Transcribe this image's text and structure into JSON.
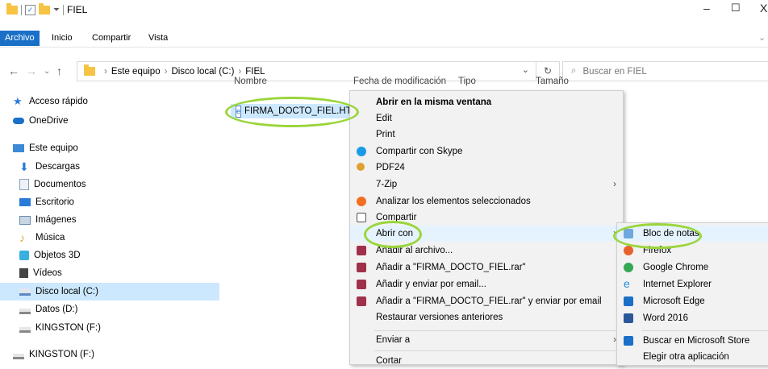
{
  "window": {
    "title": "FIEL",
    "controls": {
      "minimize": "–",
      "maximize": "☐",
      "close": "X"
    }
  },
  "ribbon": {
    "tabs": [
      {
        "label": "Archivo"
      },
      {
        "label": "Inicio"
      },
      {
        "label": "Compartir"
      },
      {
        "label": "Vista"
      }
    ],
    "expand_chevron": "⌄"
  },
  "address": {
    "crumbs": [
      "Este equipo",
      "Disco local (C:)",
      "FIEL"
    ],
    "dropdown_glyph": "⌄",
    "refresh_glyph": "↻",
    "search_placeholder": "Buscar en FIEL"
  },
  "sidebar": {
    "items": [
      {
        "label": "Acceso rápido",
        "icon": "star-icon",
        "color": "#2a7ad8"
      },
      {
        "label": "OneDrive",
        "icon": "cloud-icon",
        "color": "#1a6fc7"
      },
      {
        "label": "Este equipo",
        "icon": "computer-icon",
        "color": "#3b8ad8"
      },
      {
        "label": "Descargas",
        "icon": "download-arrow-icon",
        "color": "#2a7ad8"
      },
      {
        "label": "Documentos",
        "icon": "document-icon",
        "color": "#8aa0b8"
      },
      {
        "label": "Escritorio",
        "icon": "desktop-icon",
        "color": "#2a7ad8"
      },
      {
        "label": "Imágenes",
        "icon": "picture-icon",
        "color": "#6a8cb0"
      },
      {
        "label": "Música",
        "icon": "music-note-icon",
        "color": "#e6a23c"
      },
      {
        "label": "Objetos 3D",
        "icon": "cube-icon",
        "color": "#3ab0e0"
      },
      {
        "label": "Vídeos",
        "icon": "film-icon",
        "color": "#444444"
      },
      {
        "label": "Disco local (C:)",
        "icon": "drive-icon",
        "color": "#5a8ac0"
      },
      {
        "label": "Datos (D:)",
        "icon": "drive-icon",
        "color": "#888888"
      },
      {
        "label": "KINGSTON (F:)",
        "icon": "usb-drive-icon",
        "color": "#888888"
      },
      {
        "label": "KINGSTON (F:)",
        "icon": "usb-drive-icon",
        "color": "#888888"
      }
    ]
  },
  "file_list": {
    "columns": [
      "Nombre",
      "Fecha de modificación",
      "Tipo",
      "Tamaño"
    ],
    "files": [
      {
        "name": "FIRMA_DOCTO_FIEL.HTML",
        "icon": "html-file-icon"
      }
    ]
  },
  "context_menu": {
    "items": [
      {
        "label": "Abrir en la misma ventana",
        "bold": true
      },
      {
        "label": "Edit"
      },
      {
        "label": "Print"
      },
      {
        "label": "Compartir con Skype",
        "icon": "skype-icon",
        "color": "#1a9be6"
      },
      {
        "label": "PDF24",
        "icon": "pdf24-icon",
        "color": "#e0a030"
      },
      {
        "label": "7-Zip",
        "submenu": true
      },
      {
        "label": "Analizar los elementos seleccionados",
        "icon": "avast-icon",
        "color": "#f07020"
      },
      {
        "label": "Compartir",
        "icon": "share-icon",
        "color": "#555555"
      },
      {
        "label": "Abrir con",
        "submenu": true,
        "hover": true
      },
      {
        "label": "Añadir al archivo...",
        "icon": "winrar-icon",
        "color": "#a0304a"
      },
      {
        "label": "Añadir a \"FIRMA_DOCTO_FIEL.rar\"",
        "icon": "winrar-icon",
        "color": "#a0304a"
      },
      {
        "label": "Añadir y enviar por email...",
        "icon": "winrar-icon",
        "color": "#a0304a"
      },
      {
        "label": "Añadir a \"FIRMA_DOCTO_FIEL.rar\" y enviar por email",
        "icon": "winrar-icon",
        "color": "#a0304a"
      },
      {
        "label": "Restaurar versiones anteriores"
      },
      {
        "label": "Enviar a",
        "submenu": true
      },
      {
        "label": "Cortar"
      }
    ],
    "submenu_arrow": "›"
  },
  "open_with_menu": {
    "items": [
      {
        "label": "Bloc de notas",
        "icon": "notepad-icon",
        "color": "#6fa8dc",
        "hover": true
      },
      {
        "label": "Firefox",
        "icon": "firefox-icon",
        "color": "#e8612c"
      },
      {
        "label": "Google Chrome",
        "icon": "chrome-icon",
        "color": "#34a853"
      },
      {
        "label": "Internet Explorer",
        "icon": "ie-icon",
        "color": "#2a8ad8"
      },
      {
        "label": "Microsoft Edge",
        "icon": "edge-icon",
        "color": "#1a6fc7"
      },
      {
        "label": "Word 2016",
        "icon": "word-icon",
        "color": "#2b579a"
      },
      {
        "label": "Buscar en Microsoft Store",
        "icon": "store-icon",
        "color": "#1a6fc7"
      },
      {
        "label": "Elegir otra aplicación"
      }
    ]
  },
  "highlight_color": "#9ad53a",
  "selection_color": "#cce8ff"
}
